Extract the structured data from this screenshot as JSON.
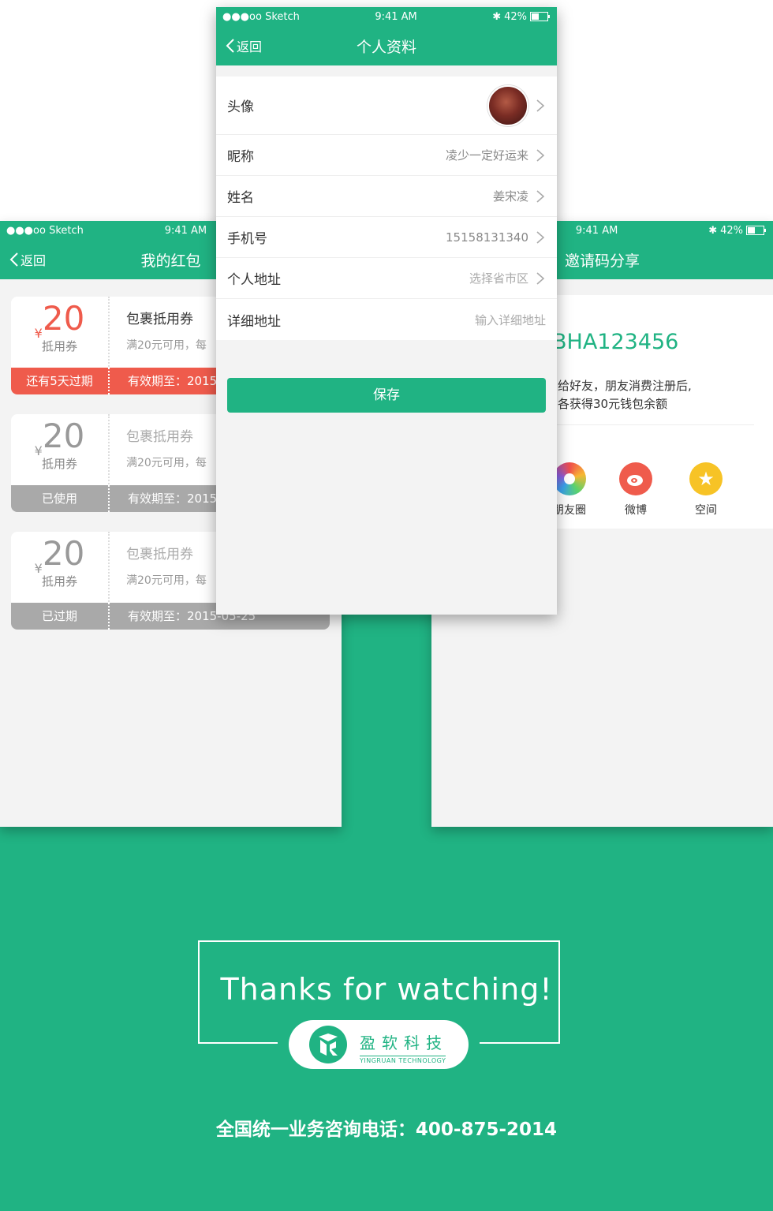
{
  "colors": {
    "brand": "#20b383",
    "warning": "#ef5b4c",
    "muted": "#a9a9a9"
  },
  "left_phone": {
    "status": {
      "carrier": "●●●oo Sketch",
      "time": "9:41 AM"
    },
    "nav": {
      "back": "返回",
      "title": "我的红包"
    },
    "coupons": [
      {
        "yen": "¥",
        "amount": "20",
        "kind": "抵用券",
        "name": "包裹抵用券",
        "cond": "满20元可用，每",
        "status": "还有5天过期",
        "valid": "有效期至：2015"
      },
      {
        "yen": "¥",
        "amount": "20",
        "kind": "抵用券",
        "name": "包裹抵用券",
        "cond": "满20元可用，每",
        "status": "已使用",
        "valid": "有效期至：2015"
      },
      {
        "yen": "¥",
        "amount": "20",
        "kind": "抵用券",
        "name": "包裹抵用券",
        "cond": "满20元可用，每",
        "status": "已过期",
        "valid": "有效期至：2015-05-25"
      }
    ]
  },
  "right_phone": {
    "status": {
      "time": "9:41 AM",
      "battery": "42%"
    },
    "nav": {
      "title": "邀请码分享"
    },
    "code": "BHA123456",
    "desc_line1": "给好友，朋友消费注册后,",
    "desc_line2": "各获得30元钱包余额",
    "share": [
      {
        "label": "朋友圈",
        "icon": "moments-icon"
      },
      {
        "label": "微博",
        "icon": "weibo-icon"
      },
      {
        "label": "空间",
        "icon": "qzone-icon"
      }
    ]
  },
  "center_phone": {
    "status": {
      "carrier": "●●●oo Sketch",
      "time": "9:41 AM",
      "battery": "42%"
    },
    "nav": {
      "back": "返回",
      "title": "个人资料"
    },
    "rows": {
      "avatar": {
        "label": "头像"
      },
      "nickname": {
        "label": "昵称",
        "value": "凌少一定好运来"
      },
      "name": {
        "label": "姓名",
        "value": "姜宋凌"
      },
      "phone": {
        "label": "手机号",
        "value": "15158131340"
      },
      "address": {
        "label": "个人地址",
        "placeholder": "选择省市区"
      },
      "detail": {
        "label": "详细地址",
        "placeholder": "输入详细地址"
      }
    },
    "save": "保存"
  },
  "footer": {
    "thanks": "Thanks for watching!",
    "logo_cn": "盈软科技",
    "logo_en": "YINGRUAN TECHNOLOGY",
    "hotline": "全国统一业务咨询电话：400-875-2014"
  }
}
